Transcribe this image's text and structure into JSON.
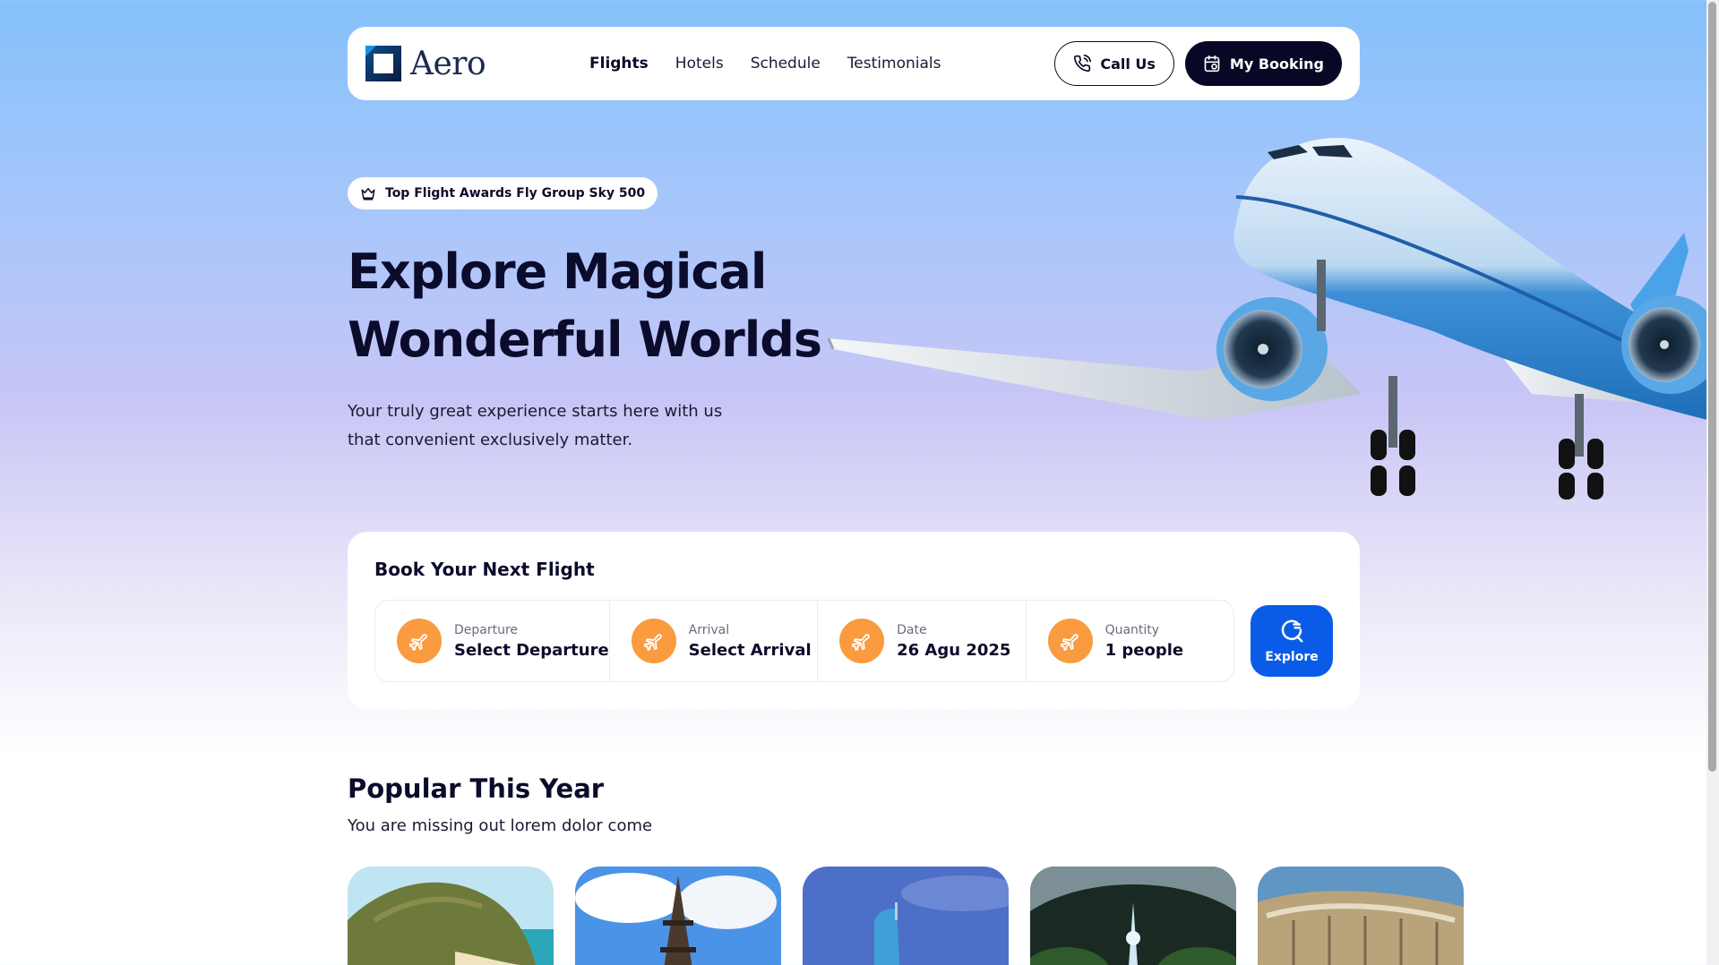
{
  "brand": {
    "name": "Aero"
  },
  "nav": {
    "links": [
      "Flights",
      "Hotels",
      "Schedule",
      "Testimonials"
    ],
    "active": "Flights",
    "call_label": "Call Us",
    "booking_label": "My Booking"
  },
  "hero": {
    "badge": "Top Flight Awards Fly Group Sky 500",
    "title_line1": "Explore Magical",
    "title_line2": "Wonderful Worlds",
    "subtitle_line1": "Your truly great experience starts here with us",
    "subtitle_line2": "that convenient exclusively matter."
  },
  "booking": {
    "title": "Book Your Next Flight",
    "fields": [
      {
        "label": "Departure",
        "value": "Select Departure",
        "icon": "plane-icon"
      },
      {
        "label": "Arrival",
        "value": "Select Arrival",
        "icon": "plane-icon"
      },
      {
        "label": "Date",
        "value": "26 Agu 2025",
        "icon": "plane-icon"
      },
      {
        "label": "Quantity",
        "value": "1 people",
        "icon": "plane-icon"
      }
    ],
    "explore_label": "Explore"
  },
  "popular": {
    "title": "Popular This Year",
    "subtitle": "You are missing out lorem dolor come"
  },
  "colors": {
    "accent_orange": "#f99b3e",
    "accent_blue": "#0a5ce8",
    "dark": "#080826"
  }
}
